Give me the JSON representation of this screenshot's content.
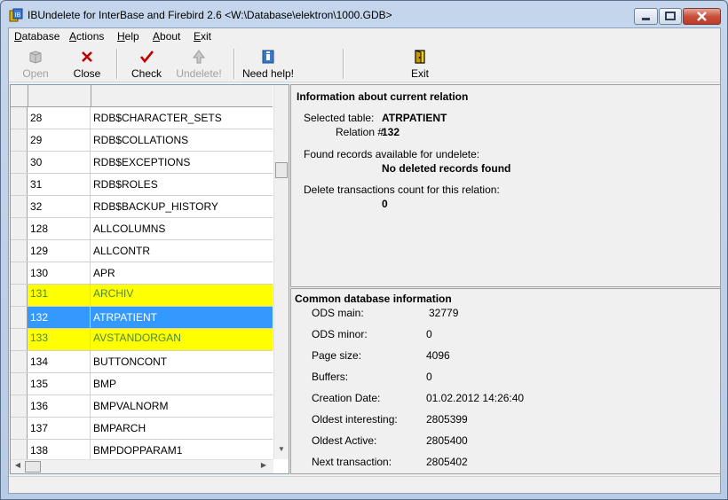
{
  "window": {
    "title": "IBUndelete for InterBase and Firebird 2.6 <W:\\Database\\elektron\\1000.GDB>"
  },
  "menu": [
    {
      "label": "Database",
      "ul": "D",
      "rest": "atabase"
    },
    {
      "label": "Actions",
      "ul": "A",
      "rest": "ctions"
    },
    {
      "label": "Help",
      "ul": "H",
      "rest": "elp"
    },
    {
      "label": "About",
      "ul": "A",
      "rest": "bout"
    },
    {
      "label": "Exit",
      "ul": "E",
      "rest": "xit"
    }
  ],
  "toolbar": {
    "open": "Open",
    "close": "Close",
    "check": "Check",
    "undelete": "Undelete!",
    "help": "Need help!",
    "exit": "Exit"
  },
  "grid": {
    "rows": [
      {
        "id": "28",
        "name": "RDB$CHARACTER_SETS",
        "state": "normal"
      },
      {
        "id": "29",
        "name": "RDB$COLLATIONS",
        "state": "normal"
      },
      {
        "id": "30",
        "name": "RDB$EXCEPTIONS",
        "state": "normal"
      },
      {
        "id": "31",
        "name": "RDB$ROLES",
        "state": "normal"
      },
      {
        "id": "32",
        "name": "RDB$BACKUP_HISTORY",
        "state": "normal"
      },
      {
        "id": "128",
        "name": "ALLCOLUMNS",
        "state": "normal"
      },
      {
        "id": "129",
        "name": "ALLCONTR",
        "state": "normal"
      },
      {
        "id": "130",
        "name": "APR",
        "state": "normal"
      },
      {
        "id": "131",
        "name": "ARCHIV",
        "state": "highlight"
      },
      {
        "id": "132",
        "name": "ATRPATIENT",
        "state": "selected"
      },
      {
        "id": "133",
        "name": "AVSTANDORGAN",
        "state": "highlight"
      },
      {
        "id": "134",
        "name": "BUTTONCONT",
        "state": "normal"
      },
      {
        "id": "135",
        "name": "BMP",
        "state": "normal"
      },
      {
        "id": "136",
        "name": "BMPVALNORM",
        "state": "normal"
      },
      {
        "id": "137",
        "name": "BMPARCH",
        "state": "normal"
      },
      {
        "id": "138",
        "name": "BMPDOPPARAM1",
        "state": "normal"
      }
    ],
    "scroll_position_fraction": 0.21
  },
  "relation": {
    "heading": "Information about current relation",
    "selected_label": "Selected  table:",
    "selected_value": "ATRPATIENT",
    "relation_label": "Relation #:",
    "relation_value": "132",
    "found_label": "Found records available for undelete:",
    "found_value": "No deleted records found",
    "delete_label": "Delete transactions count for this relation:",
    "delete_value": "0"
  },
  "dbinfo": {
    "heading": "Common database information",
    "items": [
      {
        "label": "ODS main:",
        "value": "32779"
      },
      {
        "label": "ODS minor:",
        "value": "0"
      },
      {
        "label": "Page size:",
        "value": "4096"
      },
      {
        "label": "Buffers:",
        "value": "0"
      },
      {
        "label": "Creation Date:",
        "value": "01.02.2012 14:26:40"
      },
      {
        "label": "Oldest interesting:",
        "value": "2805399"
      },
      {
        "label": "Oldest Active:",
        "value": "2805400"
      },
      {
        "label": "Next transaction:",
        "value": "2805402"
      }
    ]
  },
  "colors": {
    "highlight_bg": "#ffff00",
    "highlight_text": "#4a8a3a",
    "selected_bg": "#3399ff"
  },
  "icons": {
    "open": "open-folder-icon",
    "close": "close-x-icon",
    "check": "check-mark-icon",
    "undelete": "undelete-arrow-icon",
    "help": "help-book-icon",
    "exit": "exit-door-icon"
  }
}
